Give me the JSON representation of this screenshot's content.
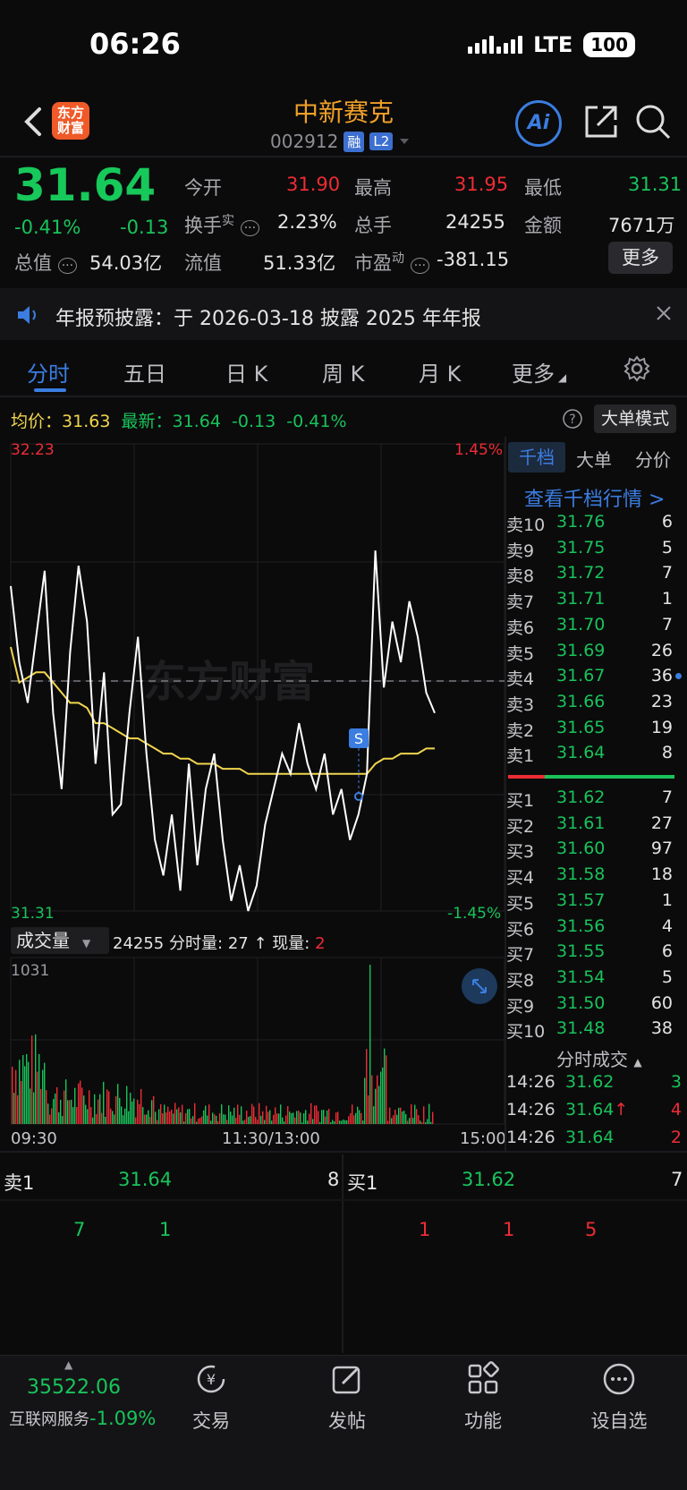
{
  "status": {
    "time": "06:26",
    "network": "LTE",
    "battery": "100"
  },
  "header": {
    "logo_line1": "东方",
    "logo_line2": "财富",
    "name": "中新赛克",
    "code": "002912",
    "tag_margin": "融",
    "tag_level": "L2",
    "ai_label": "Ai"
  },
  "quote": {
    "price": "31.64",
    "change_pct": "-0.41%",
    "change": "-0.13",
    "open_label": "今开",
    "open": "31.90",
    "high_label": "最高",
    "high": "31.95",
    "low_label": "最低",
    "low": "31.31",
    "turnover_label": "换手",
    "turnover_sup": "实",
    "turnover": "2.23%",
    "volume_label": "总手",
    "volume": "24255",
    "amount_label": "金额",
    "amount": "7671万",
    "mktcap_label": "总值",
    "mktcap": "54.03亿",
    "float_label": "流值",
    "float": "51.33亿",
    "pe_label": "市盈",
    "pe_sup": "动",
    "pe": "-381.15",
    "more": "更多"
  },
  "notice": {
    "text": "年报预披露：于 2026-03-18 披露 2025 年年报"
  },
  "tabs": [
    "分时",
    "五日",
    "日 K",
    "周 K",
    "月 K",
    "更多"
  ],
  "chart_header": {
    "avg_label": "均价：",
    "avg": "31.63",
    "latest_label": "最新：",
    "latest": "31.64",
    "chg": "-0.13",
    "chg_pct": "-0.41%",
    "mode_button": "大单模式"
  },
  "chart_labels": {
    "y_max": "32.23",
    "y_min": "31.31",
    "pct_max": "1.45%",
    "pct_min": "-1.45%",
    "watermark": "东方财富",
    "signal": "S",
    "vol_select": "成交量",
    "vol_total": "24255",
    "vol_minute_label": "分时量:",
    "vol_minute": "27",
    "vol_now_label": "现量:",
    "vol_now": "2",
    "vol_max": "1031",
    "t_start": "09:30",
    "t_mid": "11:30/13:00",
    "t_end": "15:00"
  },
  "chart_data": {
    "type": "line",
    "title": "",
    "ylim": [
      31.31,
      32.23
    ],
    "x": [
      "09:30",
      "11:30/13:00",
      "15:00"
    ],
    "series": [
      {
        "name": "最新",
        "color": "#ffffff",
        "values": [
          31.95,
          31.8,
          31.72,
          31.85,
          31.98,
          31.7,
          31.55,
          31.82,
          31.99,
          31.88,
          31.6,
          31.78,
          31.5,
          31.52,
          31.7,
          31.85,
          31.62,
          31.45,
          31.38,
          31.5,
          31.35,
          31.6,
          31.4,
          31.55,
          31.62,
          31.45,
          31.33,
          31.4,
          31.31,
          31.36,
          31.48,
          31.55,
          31.62,
          31.58,
          31.68,
          31.6,
          31.55,
          31.62,
          31.5,
          31.55,
          31.45,
          31.5,
          31.58,
          32.02,
          31.75,
          31.88,
          31.8,
          31.92,
          31.85,
          31.74,
          31.7
        ]
      },
      {
        "name": "均价",
        "color": "#f1d54e",
        "values": [
          31.83,
          31.76,
          31.77,
          31.78,
          31.78,
          31.76,
          31.74,
          31.72,
          31.72,
          31.71,
          31.68,
          31.68,
          31.67,
          31.66,
          31.65,
          31.65,
          31.64,
          31.63,
          31.62,
          31.62,
          31.61,
          31.61,
          31.6,
          31.6,
          31.6,
          31.59,
          31.59,
          31.59,
          31.58,
          31.58,
          31.58,
          31.58,
          31.58,
          31.58,
          31.58,
          31.58,
          31.58,
          31.58,
          31.58,
          31.58,
          31.58,
          31.58,
          31.58,
          31.6,
          31.61,
          31.61,
          31.62,
          31.62,
          31.62,
          31.63,
          31.63
        ]
      }
    ],
    "prev_close": 31.77,
    "volume_max": 1031
  },
  "orderbook": {
    "tabs": [
      "千档",
      "大单",
      "分价"
    ],
    "link": "查看千档行情 >",
    "asks": [
      {
        "label": "卖10",
        "price": "31.76",
        "qty": "6"
      },
      {
        "label": "卖9",
        "price": "31.75",
        "qty": "5"
      },
      {
        "label": "卖8",
        "price": "31.72",
        "qty": "7"
      },
      {
        "label": "卖7",
        "price": "31.71",
        "qty": "1"
      },
      {
        "label": "卖6",
        "price": "31.70",
        "qty": "7"
      },
      {
        "label": "卖5",
        "price": "31.69",
        "qty": "26"
      },
      {
        "label": "卖4",
        "price": "31.67",
        "qty": "36"
      },
      {
        "label": "卖3",
        "price": "31.66",
        "qty": "23"
      },
      {
        "label": "卖2",
        "price": "31.65",
        "qty": "19"
      },
      {
        "label": "卖1",
        "price": "31.64",
        "qty": "8"
      }
    ],
    "bids": [
      {
        "label": "买1",
        "price": "31.62",
        "qty": "7"
      },
      {
        "label": "买2",
        "price": "31.61",
        "qty": "27"
      },
      {
        "label": "买3",
        "price": "31.60",
        "qty": "97"
      },
      {
        "label": "买4",
        "price": "31.58",
        "qty": "18"
      },
      {
        "label": "买5",
        "price": "31.57",
        "qty": "1"
      },
      {
        "label": "买6",
        "price": "31.56",
        "qty": "4"
      },
      {
        "label": "买7",
        "price": "31.55",
        "qty": "6"
      },
      {
        "label": "买8",
        "price": "31.54",
        "qty": "5"
      },
      {
        "label": "买9",
        "price": "31.50",
        "qty": "60"
      },
      {
        "label": "买10",
        "price": "31.48",
        "qty": "38"
      }
    ],
    "trades_title": "分时成交",
    "trades": [
      {
        "time": "14:26",
        "price": "31.62",
        "vol": "3",
        "arrow": ""
      },
      {
        "time": "14:26",
        "price": "31.64",
        "vol": "4",
        "arrow": "↑"
      },
      {
        "time": "14:26",
        "price": "31.64",
        "vol": "2",
        "arrow": ""
      }
    ]
  },
  "queue": {
    "ask_label": "卖1",
    "ask_price": "31.64",
    "ask_qty": "8",
    "bid_label": "买1",
    "bid_price": "31.62",
    "bid_qty": "7",
    "ask_orders": [
      "7",
      "1"
    ],
    "bid_orders": [
      "1",
      "1",
      "5"
    ]
  },
  "bottom": {
    "index_value": "35522.06",
    "index_name": "互联网服务",
    "index_pct": "-1.09%",
    "nav": [
      "交易",
      "发帖",
      "功能",
      "设自选"
    ]
  }
}
